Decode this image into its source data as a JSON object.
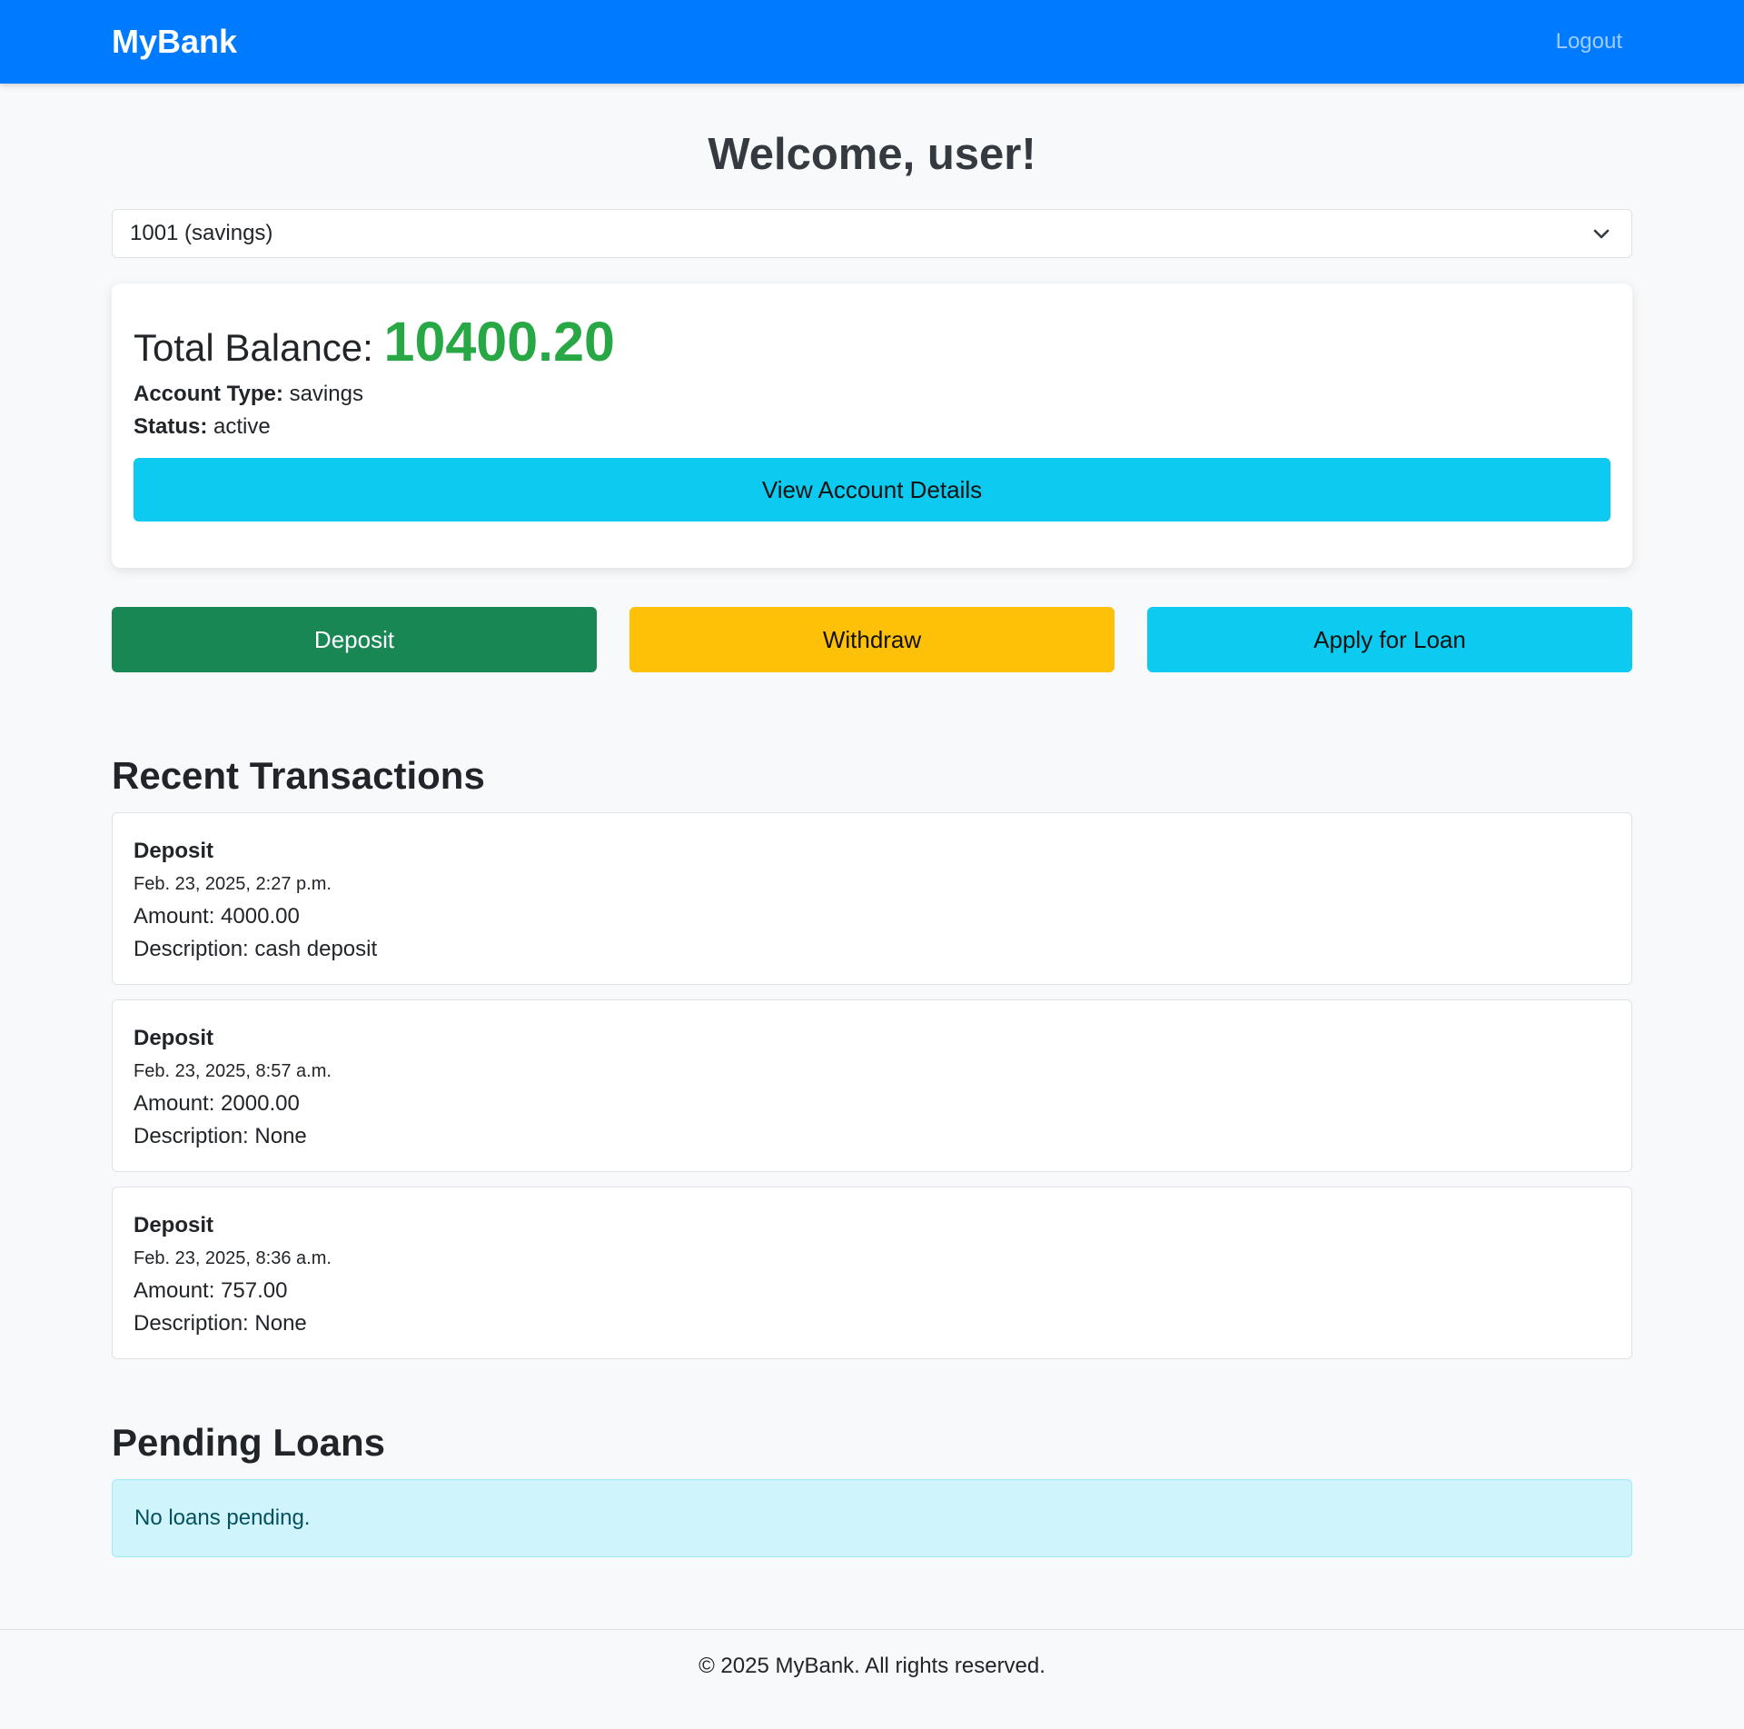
{
  "navbar": {
    "brand": "MyBank",
    "logout_label": "Logout",
    "color": "#007bff"
  },
  "welcome": "Welcome, user!",
  "account_select": {
    "selected": "1001 (savings)",
    "icon": "chevron-down-icon"
  },
  "balance_card": {
    "label": "Total Balance:",
    "value": "10400.20",
    "value_color": "#28a745",
    "account_type_label": "Account Type:",
    "account_type": "savings",
    "status_label": "Status:",
    "status": "active",
    "view_button": "View Account Details"
  },
  "actions": {
    "deposit": "Deposit",
    "withdraw": "Withdraw",
    "apply_loan": "Apply for Loan"
  },
  "transactions": {
    "title": "Recent Transactions",
    "items": [
      {
        "type": "Deposit",
        "date": "Feb. 23, 2025, 2:27 p.m.",
        "amount": "Amount: 4000.00",
        "description": "Description: cash deposit"
      },
      {
        "type": "Deposit",
        "date": "Feb. 23, 2025, 8:57 a.m.",
        "amount": "Amount: 2000.00",
        "description": "Description: None"
      },
      {
        "type": "Deposit",
        "date": "Feb. 23, 2025, 8:36 a.m.",
        "amount": "Amount: 757.00",
        "description": "Description: None"
      }
    ]
  },
  "loans": {
    "title": "Pending Loans",
    "message": "No loans pending."
  },
  "footer": {
    "text": "© 2025 MyBank. All rights reserved."
  }
}
